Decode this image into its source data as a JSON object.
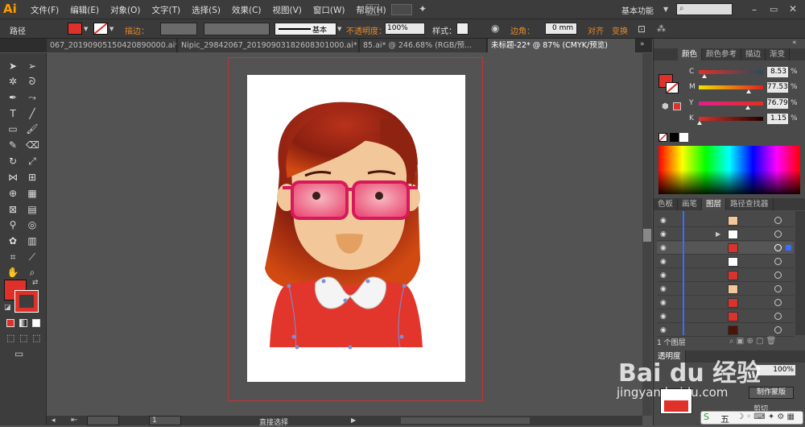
{
  "app": {
    "logo": "Ai",
    "workspace": "基本功能"
  },
  "menu": [
    "文件(F)",
    "编辑(E)",
    "对象(O)",
    "文字(T)",
    "选择(S)",
    "效果(C)",
    "视图(V)",
    "窗口(W)",
    "帮助(H)"
  ],
  "control": {
    "selection": "路径",
    "stroke_label": "描边：",
    "stroke_style": "基本",
    "opacity_label": "不透明度：",
    "opacity_value": "100%",
    "style_label": "样式：",
    "corner_label": "边角：",
    "corner_value": "0 mm",
    "align": "对齐",
    "transform": "变换",
    "fill_color": "#e0302a"
  },
  "tabs": [
    {
      "label": "067_20190905150420890000.ai*"
    },
    {
      "label": "Nipic_29842067_20190903182608301000.ai*"
    },
    {
      "label": "85.ai* @ 246.68% (RGB/预..."
    },
    {
      "label": "未标题-22* @ 87% (CMYK/预览)"
    }
  ],
  "color_panel": {
    "tabs": [
      "颜色",
      "颜色参考",
      "描边",
      "渐变"
    ],
    "channels": [
      {
        "letter": "C",
        "value": "8.53",
        "fraction": 0.085
      },
      {
        "letter": "M",
        "value": "77.53",
        "fraction": 0.775
      },
      {
        "letter": "Y",
        "value": "76.79",
        "fraction": 0.768
      },
      {
        "letter": "K",
        "value": "1.15",
        "fraction": 0.012
      }
    ],
    "percent": "%"
  },
  "layers_panel": {
    "tabs": [
      "色板",
      "画笔",
      "图层",
      "路径查找器"
    ],
    "rows": [
      {
        "thumb": "#f2c79a"
      },
      {
        "thumb": "#ffffff"
      },
      {
        "thumb": "#d7342c"
      },
      {
        "thumb": "#ffffff"
      },
      {
        "thumb": "#d7342c"
      },
      {
        "thumb": "#f2c79a"
      },
      {
        "thumb": "#d7342c"
      },
      {
        "thumb": "#d7342c"
      },
      {
        "thumb": "#ffffff"
      },
      {
        "thumb": "#4a1508"
      }
    ],
    "footer": "1 个图层"
  },
  "bottom_panel": {
    "tab": "透明度",
    "opacity": "100%",
    "make_mask": "制作蒙版",
    "clip": "剪切"
  },
  "status": {
    "tool": "直接选择",
    "zoom": "1"
  },
  "watermark": {
    "brand": "Bai du 经验",
    "url": "jingyan.baidu.com"
  },
  "ime": "五"
}
